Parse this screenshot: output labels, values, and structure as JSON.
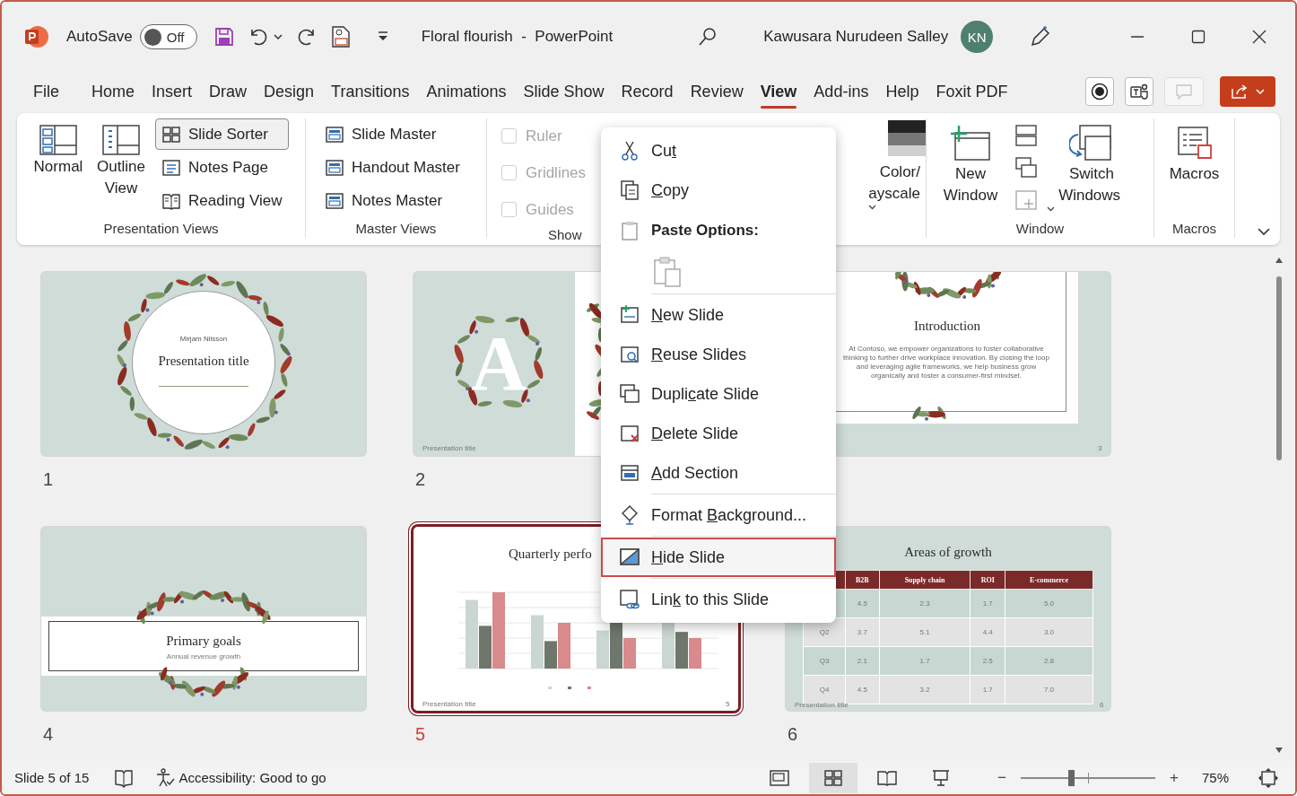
{
  "title_bar": {
    "autosave_label": "AutoSave",
    "autosave_on": false,
    "autosave_state": "Off",
    "document_title": "Floral flourish  -  PowerPoint",
    "user_name": "Kawusara Nurudeen Salley",
    "avatar_initials": "KN"
  },
  "menu_tabs": [
    {
      "label": "File",
      "selected": false
    },
    {
      "label": "Home",
      "selected": false
    },
    {
      "label": "Insert",
      "selected": false
    },
    {
      "label": "Draw",
      "selected": false
    },
    {
      "label": "Design",
      "selected": false
    },
    {
      "label": "Transitions",
      "selected": false
    },
    {
      "label": "Animations",
      "selected": false
    },
    {
      "label": "Slide Show",
      "selected": false
    },
    {
      "label": "Record",
      "selected": false
    },
    {
      "label": "Review",
      "selected": false
    },
    {
      "label": "View",
      "selected": true
    },
    {
      "label": "Add-ins",
      "selected": false
    },
    {
      "label": "Help",
      "selected": false
    },
    {
      "label": "Foxit PDF",
      "selected": false
    }
  ],
  "ribbon": {
    "presentation_views": {
      "label": "Presentation Views",
      "buttons": [
        {
          "label": "Normal",
          "selected": false
        },
        {
          "label": "Outline View",
          "selected": false
        },
        {
          "label": "Slide Sorter",
          "selected": true
        },
        {
          "label": "Notes Page",
          "selected": false
        },
        {
          "label": "Reading View",
          "selected": false
        }
      ]
    },
    "master_views": {
      "label": "Master Views",
      "buttons": [
        "Slide Master",
        "Handout Master",
        "Notes Master"
      ]
    },
    "show": {
      "label": "Show",
      "checkboxes": [
        {
          "label": "Ruler",
          "checked": false,
          "disabled": true
        },
        {
          "label": "Gridlines",
          "checked": false,
          "disabled": true
        },
        {
          "label": "Guides",
          "checked": false,
          "disabled": true
        }
      ]
    },
    "color": {
      "lines": [
        "Color/",
        "ayscale"
      ]
    },
    "window": {
      "label": "Window",
      "buttons": [
        "New Window",
        "Switch Windows"
      ]
    },
    "macros": {
      "label": "Macros",
      "buttons": [
        "Macros"
      ]
    }
  },
  "slides": [
    {
      "kind": "title",
      "number": "1",
      "selected": false,
      "subtitle": "Mirjam Nilsson",
      "title": "Presentation title"
    },
    {
      "kind": "letter",
      "number": "2",
      "selected": false,
      "letter": "A",
      "footer": "Presentation title"
    },
    {
      "kind": "text",
      "selected": false,
      "title": "Introduction",
      "body": "At Contoso, we empower organizations to foster collaborative thinking to further drive workplace innovation. By closing the loop and leveraging agile frameworks, we help business grow organically and foster a consumer-first mindset.",
      "page": "3"
    },
    {
      "kind": "band",
      "number": "4",
      "selected": false,
      "title": "Primary goals",
      "subtitle": "Annual revenue growth"
    },
    {
      "kind": "chart",
      "number": "5",
      "selected": true,
      "title": "Quarterly perfo",
      "footer": "Presentation title",
      "page": "5"
    },
    {
      "kind": "table",
      "number": "6",
      "selected": false,
      "title": "Areas of growth",
      "columns": [
        "B2B",
        "Supply chain",
        "ROI",
        "E-commerce"
      ],
      "rows": [
        {
          "cells": [
            "4.5",
            "2.3",
            "1.7",
            "5.0"
          ]
        },
        {
          "label": "Q2",
          "cells": [
            "3.7",
            "5.1",
            "4.4",
            "3.0"
          ]
        },
        {
          "label": "Q3",
          "cells": [
            "2.1",
            "1.7",
            "2.5",
            "2.8"
          ]
        },
        {
          "label": "Q4",
          "cells": [
            "4.5",
            "3.2",
            "1.7",
            "7.0"
          ]
        }
      ],
      "footer": "Presentation title",
      "page": "6"
    }
  ],
  "context_menu": {
    "items": [
      {
        "kind": "item",
        "parts": [
          {
            "text": "Cu",
            "access_key": false
          },
          {
            "text": "t",
            "access_key": true
          }
        ],
        "selected": false
      },
      {
        "kind": "item",
        "parts": [
          {
            "text": "C",
            "access_key": true
          },
          {
            "text": "opy",
            "access_key": false
          }
        ],
        "selected": false
      },
      {
        "kind": "heading",
        "label": "Paste Options:"
      },
      {
        "kind": "paste"
      },
      {
        "kind": "separator"
      },
      {
        "kind": "item",
        "parts": [
          {
            "text": "N",
            "access_key": true
          },
          {
            "text": "ew Slide",
            "access_key": false
          }
        ],
        "selected": false
      },
      {
        "kind": "item",
        "parts": [
          {
            "text": "R",
            "access_key": true
          },
          {
            "text": "euse Slides",
            "access_key": false
          }
        ],
        "selected": false
      },
      {
        "kind": "item",
        "parts": [
          {
            "text": "Dupli",
            "access_key": false
          },
          {
            "text": "c",
            "access_key": true
          },
          {
            "text": "ate Slide",
            "access_key": false
          }
        ],
        "selected": false
      },
      {
        "kind": "item",
        "parts": [
          {
            "text": "D",
            "access_key": true
          },
          {
            "text": "elete Slide",
            "access_key": false
          }
        ],
        "selected": false
      },
      {
        "kind": "item",
        "parts": [
          {
            "text": "A",
            "access_key": true
          },
          {
            "text": "dd Section",
            "access_key": false
          }
        ],
        "selected": false
      },
      {
        "kind": "separator"
      },
      {
        "kind": "item",
        "parts": [
          {
            "text": "Format ",
            "access_key": false
          },
          {
            "text": "B",
            "access_key": true
          },
          {
            "text": "ackground...",
            "access_key": false
          }
        ],
        "selected": false
      },
      {
        "kind": "separator"
      },
      {
        "kind": "item",
        "parts": [
          {
            "text": "H",
            "access_key": true
          },
          {
            "text": "ide Slide",
            "access_key": false
          }
        ],
        "selected": true
      },
      {
        "kind": "separator"
      },
      {
        "kind": "item",
        "parts": [
          {
            "text": "Lin",
            "access_key": false
          },
          {
            "text": "k",
            "access_key": true
          },
          {
            "text": " to this Slide",
            "access_key": false
          }
        ],
        "selected": false
      }
    ]
  },
  "status_bar": {
    "slide_info": "Slide 5 of 15",
    "accessibility": "Accessibility: Good to go",
    "views": [
      {
        "selected": false
      },
      {
        "selected": true
      },
      {
        "selected": false
      },
      {
        "selected": false
      }
    ],
    "zoom_out": "−",
    "zoom_in": "+",
    "zoom": {
      "level": 0.37
    },
    "zoom_percent": "75%"
  }
}
